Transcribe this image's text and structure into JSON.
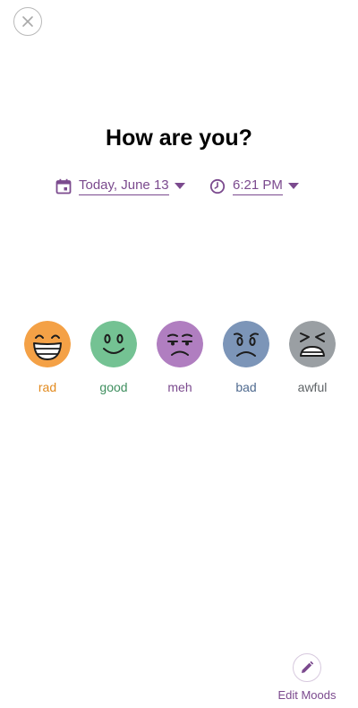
{
  "header": {
    "title": "How are you?",
    "close_icon": "close-icon"
  },
  "entry": {
    "date_label": "Today, June 13",
    "time_label": "6:21 PM",
    "date_icon": "calendar-icon",
    "time_icon": "clock-icon",
    "accent_color": "#7b4a8e"
  },
  "moods": [
    {
      "label": "rad",
      "color": "#f4a146",
      "label_color": "#e28a1e",
      "icon": "laughing-face-icon"
    },
    {
      "label": "good",
      "color": "#74c293",
      "label_color": "#3f8f5f",
      "icon": "smiling-face-icon"
    },
    {
      "label": "meh",
      "color": "#b07ec0",
      "label_color": "#7b4a8e",
      "icon": "unamused-face-icon"
    },
    {
      "label": "bad",
      "color": "#7c95b8",
      "label_color": "#4f6a8f",
      "icon": "worried-face-icon"
    },
    {
      "label": "awful",
      "color": "#9a9fa3",
      "label_color": "#5e6366",
      "icon": "tired-face-icon"
    }
  ],
  "footer": {
    "edit_label": "Edit Moods",
    "edit_icon": "pencil-icon"
  }
}
